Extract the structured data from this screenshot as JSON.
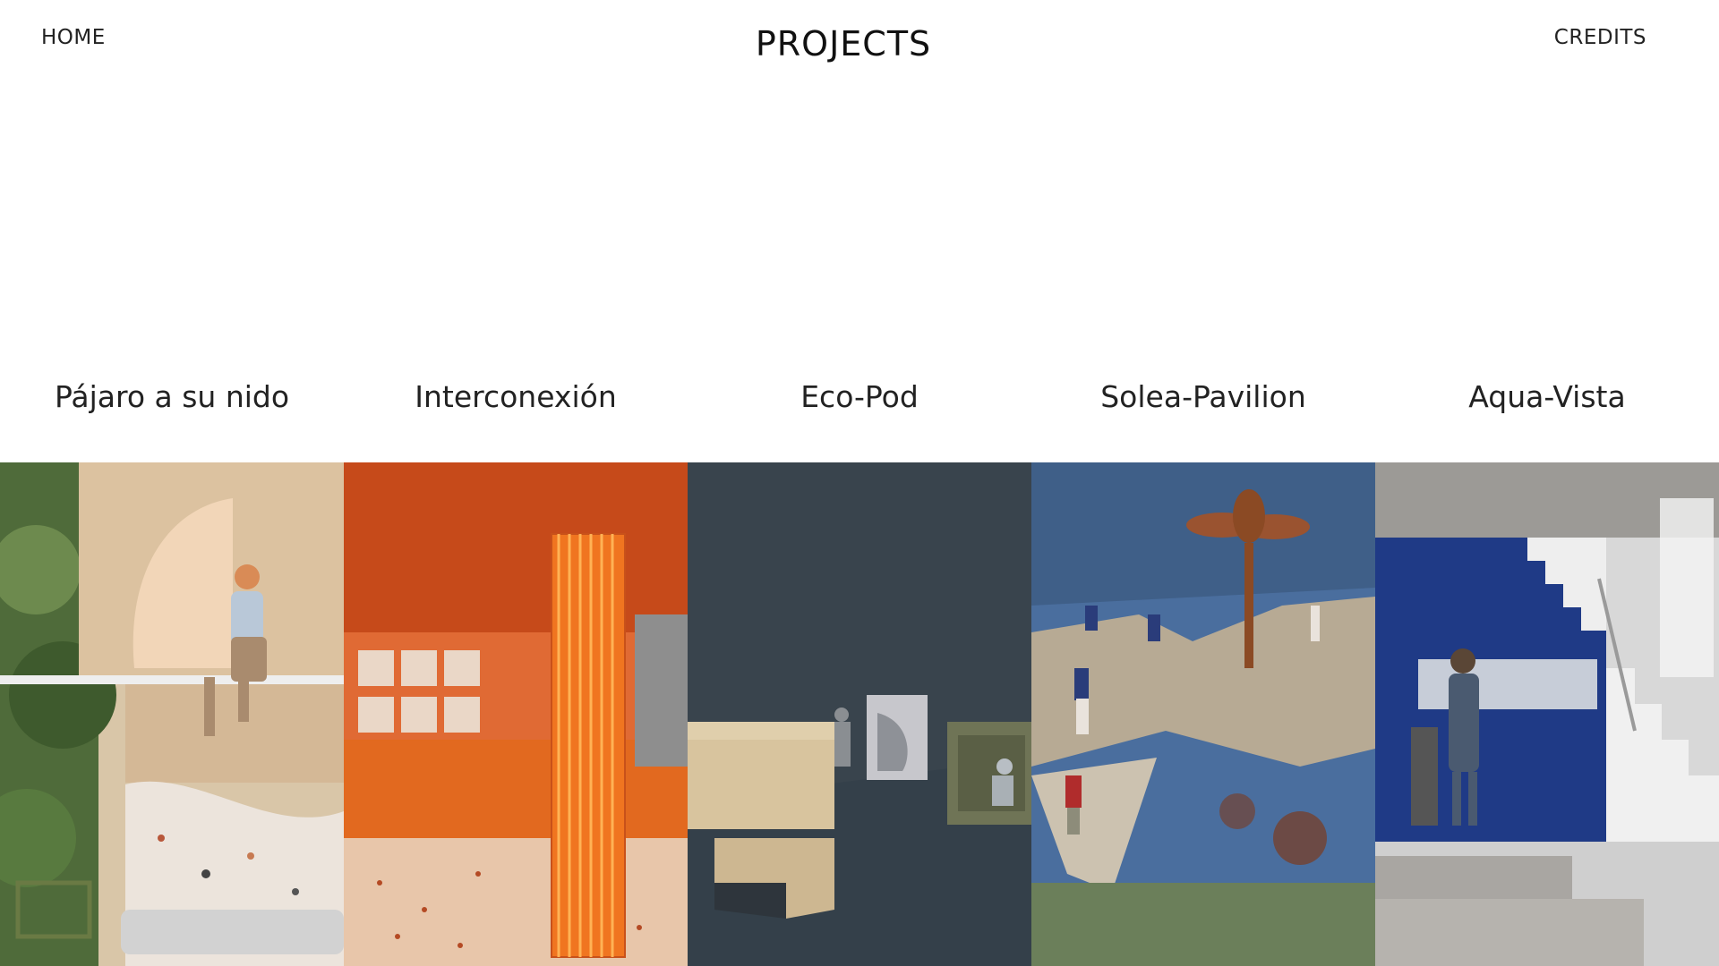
{
  "nav": {
    "home_label": "HOME",
    "credits_label": "CREDITS"
  },
  "page": {
    "title": "PROJECTS"
  },
  "projects": [
    {
      "name": "Pájaro a su nido",
      "image_icon": "render-seated-figure-on-wooden-shelf"
    },
    {
      "name": "Interconexión",
      "image_icon": "render-orange-interior-with-lattice-column"
    },
    {
      "name": "Eco-Pod",
      "image_icon": "render-modular-pods-on-dark-ground"
    },
    {
      "name": "Solea-Pavilion",
      "image_icon": "render-floating-pavilion-on-water"
    },
    {
      "name": "Aqua-Vista",
      "image_icon": "render-blue-kitchen-with-staircase"
    }
  ],
  "colors": {
    "background": "#ffffff",
    "text": "#111111"
  }
}
